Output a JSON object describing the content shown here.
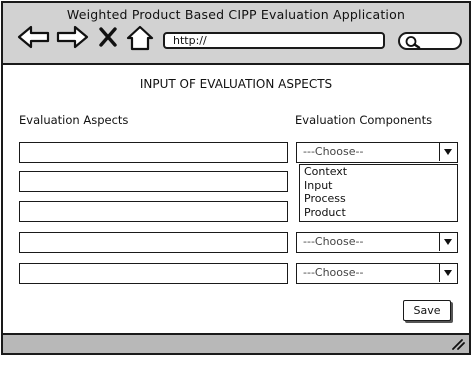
{
  "window": {
    "title": "Weighted Product Based CIPP Evaluation Application"
  },
  "toolbar": {
    "back_icon": "back-arrow-icon",
    "forward_icon": "forward-arrow-icon",
    "close_icon": "close-x-icon",
    "home_icon": "home-icon",
    "url_value": "http://",
    "search_icon": "search-icon"
  },
  "page": {
    "title": "INPUT OF EVALUATION ASPECTS",
    "aspects_header": "Evaluation Aspects",
    "components_header": "Evaluation Components"
  },
  "rows": [
    {
      "aspect_value": "",
      "component_value": "---Choose--",
      "expanded": true
    },
    {
      "aspect_value": "",
      "component_value": ""
    },
    {
      "aspect_value": "",
      "component_value": ""
    },
    {
      "aspect_value": "",
      "component_value": "---Choose--"
    },
    {
      "aspect_value": "",
      "component_value": "---Choose--"
    }
  ],
  "dropdown_options": [
    "Context",
    "Input",
    "Process",
    "Product"
  ],
  "save_label": "Save",
  "colors": {
    "chrome": "#d2d2d2",
    "statusbar": "#b8b8b8",
    "stroke": "#1a1a1a"
  }
}
